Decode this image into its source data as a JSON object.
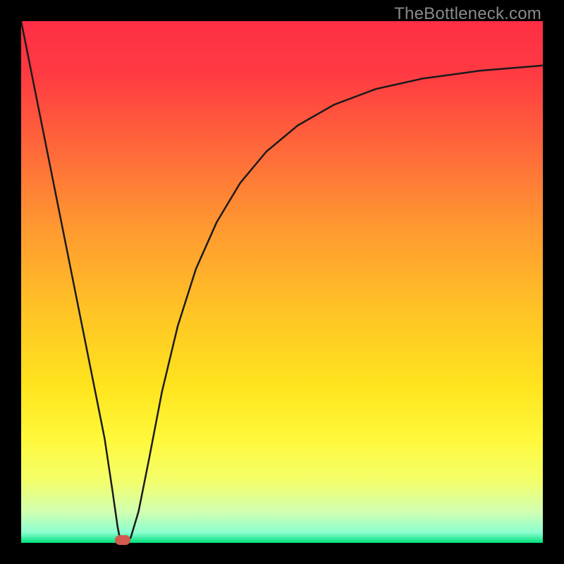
{
  "watermark": "TheBottleneck.com",
  "colors": {
    "background_black": "#000000",
    "gradient_stops": [
      {
        "offset": 0.0,
        "color": "#ff2e45"
      },
      {
        "offset": 0.1,
        "color": "#ff3a42"
      },
      {
        "offset": 0.25,
        "color": "#ff6a3a"
      },
      {
        "offset": 0.4,
        "color": "#ff9a30"
      },
      {
        "offset": 0.55,
        "color": "#ffc226"
      },
      {
        "offset": 0.7,
        "color": "#ffe41e"
      },
      {
        "offset": 0.8,
        "color": "#fff83a"
      },
      {
        "offset": 0.88,
        "color": "#f4ff6a"
      },
      {
        "offset": 0.94,
        "color": "#d2ffb0"
      },
      {
        "offset": 0.98,
        "color": "#8cffd0"
      },
      {
        "offset": 1.0,
        "color": "#00e07a"
      }
    ],
    "curve_stroke": "#1a1a1a",
    "marker_fill": "#d25a4f"
  },
  "chart_data": {
    "type": "line",
    "title": "",
    "xlabel": "",
    "ylabel": "",
    "xlim": [
      0,
      1
    ],
    "ylim": [
      0,
      1
    ],
    "marker": {
      "x": 0.195,
      "y": 0.0
    },
    "curve_points": [
      {
        "x": 0.0,
        "y": 1.0
      },
      {
        "x": 0.02,
        "y": 0.9
      },
      {
        "x": 0.04,
        "y": 0.8
      },
      {
        "x": 0.06,
        "y": 0.7
      },
      {
        "x": 0.08,
        "y": 0.6
      },
      {
        "x": 0.1,
        "y": 0.5
      },
      {
        "x": 0.12,
        "y": 0.4
      },
      {
        "x": 0.14,
        "y": 0.3
      },
      {
        "x": 0.16,
        "y": 0.2
      },
      {
        "x": 0.175,
        "y": 0.1
      },
      {
        "x": 0.185,
        "y": 0.03
      },
      {
        "x": 0.19,
        "y": 0.005
      },
      {
        "x": 0.195,
        "y": 0.0
      },
      {
        "x": 0.2,
        "y": 0.0
      },
      {
        "x": 0.21,
        "y": 0.01
      },
      {
        "x": 0.225,
        "y": 0.06
      },
      {
        "x": 0.245,
        "y": 0.16
      },
      {
        "x": 0.27,
        "y": 0.29
      },
      {
        "x": 0.3,
        "y": 0.415
      },
      {
        "x": 0.335,
        "y": 0.525
      },
      {
        "x": 0.375,
        "y": 0.615
      },
      {
        "x": 0.42,
        "y": 0.69
      },
      {
        "x": 0.47,
        "y": 0.75
      },
      {
        "x": 0.53,
        "y": 0.8
      },
      {
        "x": 0.6,
        "y": 0.84
      },
      {
        "x": 0.68,
        "y": 0.87
      },
      {
        "x": 0.77,
        "y": 0.89
      },
      {
        "x": 0.88,
        "y": 0.905
      },
      {
        "x": 1.0,
        "y": 0.915
      }
    ]
  }
}
